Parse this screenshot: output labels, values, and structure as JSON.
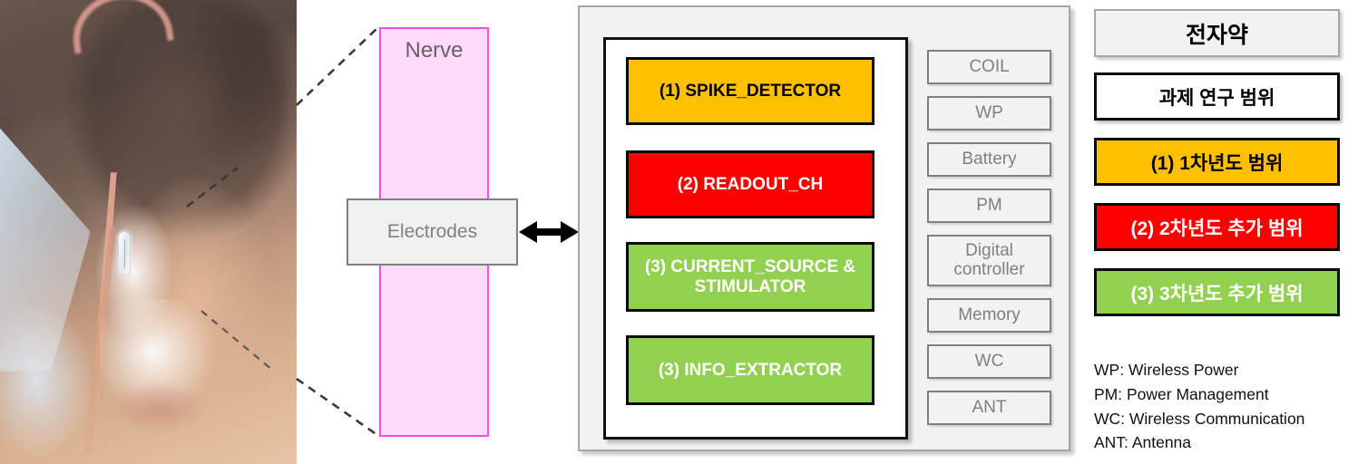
{
  "photo": {
    "alt_name": "neck-vagus-nerve-implant-photo",
    "implant_name": "implant-capsule"
  },
  "callouts": {
    "line_count": 3,
    "style": "dashed"
  },
  "nerve": {
    "label": "Nerve",
    "fill": "#FDDBF8",
    "stroke": "#EF4EE0"
  },
  "electrodes": {
    "label": "Electrodes",
    "fill": "#F0F0F0",
    "stroke": "#7F7F7F"
  },
  "arrow": {
    "name": "bidirectional-arrow"
  },
  "device": {
    "chip_blocks": [
      {
        "label": "(1) SPIKE_DETECTOR",
        "fill": "#FFC000",
        "text_color": "#000000"
      },
      {
        "label": "(2) READOUT_CH",
        "fill": "#FF0000",
        "text_color": "#FFFFFF"
      },
      {
        "label": "(3) CURRENT_SOURCE & STIMULATOR",
        "fill": "#92D050",
        "text_color": "#FFFFFF"
      },
      {
        "label": "(3) INFO_EXTRACTOR",
        "fill": "#92D050",
        "text_color": "#FFFFFF"
      }
    ],
    "subsystems": [
      {
        "label": "COIL"
      },
      {
        "label": "WP"
      },
      {
        "label": "Battery"
      },
      {
        "label": "PM"
      },
      {
        "label": "Digital controller"
      },
      {
        "label": "Memory"
      },
      {
        "label": "WC"
      },
      {
        "label": "ANT"
      }
    ]
  },
  "legend": {
    "title": "전자약",
    "scope": "과제 연구 범위",
    "year1": "(1) 1차년도 범위",
    "year2": "(2) 2차년도 추가 범위",
    "year3": "(3) 3차년도 추가 범위",
    "colors": {
      "year1": "#FFC000",
      "year2": "#FF0000",
      "year3": "#92D050",
      "title_fill": "#F2F2F2",
      "scope_fill": "#FFFFFF"
    },
    "abbreviations": [
      "WP: Wireless Power",
      "PM: Power Management",
      "WC: Wireless Communication",
      "ANT: Antenna"
    ]
  }
}
